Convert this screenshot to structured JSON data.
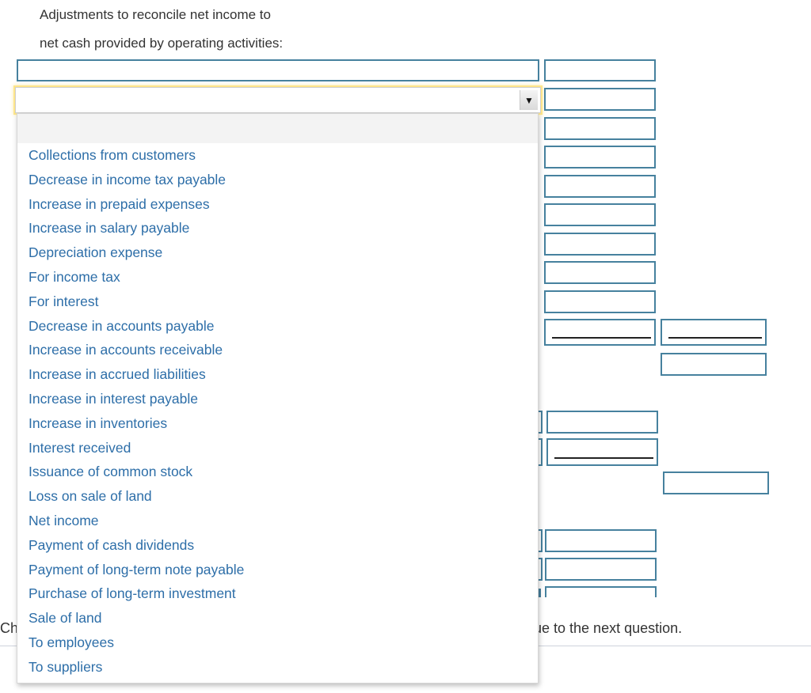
{
  "heading": {
    "line1": "Adjustments to reconcile net income to",
    "line2": "net cash provided by operating activities:"
  },
  "select": {
    "selected_value": "",
    "arrow_icon": "triangle-down-icon",
    "options": [
      "",
      "Collections from customers",
      "Decrease in income tax payable",
      "Increase in prepaid expenses",
      "Increase in salary payable",
      "Depreciation expense",
      "For income tax",
      "For interest",
      "Decrease in accounts payable",
      "Increase in accounts receivable",
      "Increase in accrued liabilities",
      "Increase in interest payable",
      "Increase in inventories",
      "Interest received",
      "Issuance of common stock",
      "Loss on sale of land",
      "Net income",
      "Payment of cash dividends",
      "Payment of long-term note payable",
      "Purchase of long-term investment",
      "Sale of land",
      "To employees",
      "To suppliers"
    ]
  },
  "footer": {
    "left_fragment": "Ch",
    "right_fragment": "ue to the next question."
  },
  "colors": {
    "field_border": "#46819e",
    "option_text": "#2d6ea8",
    "focus_glow": "#fde58a"
  }
}
